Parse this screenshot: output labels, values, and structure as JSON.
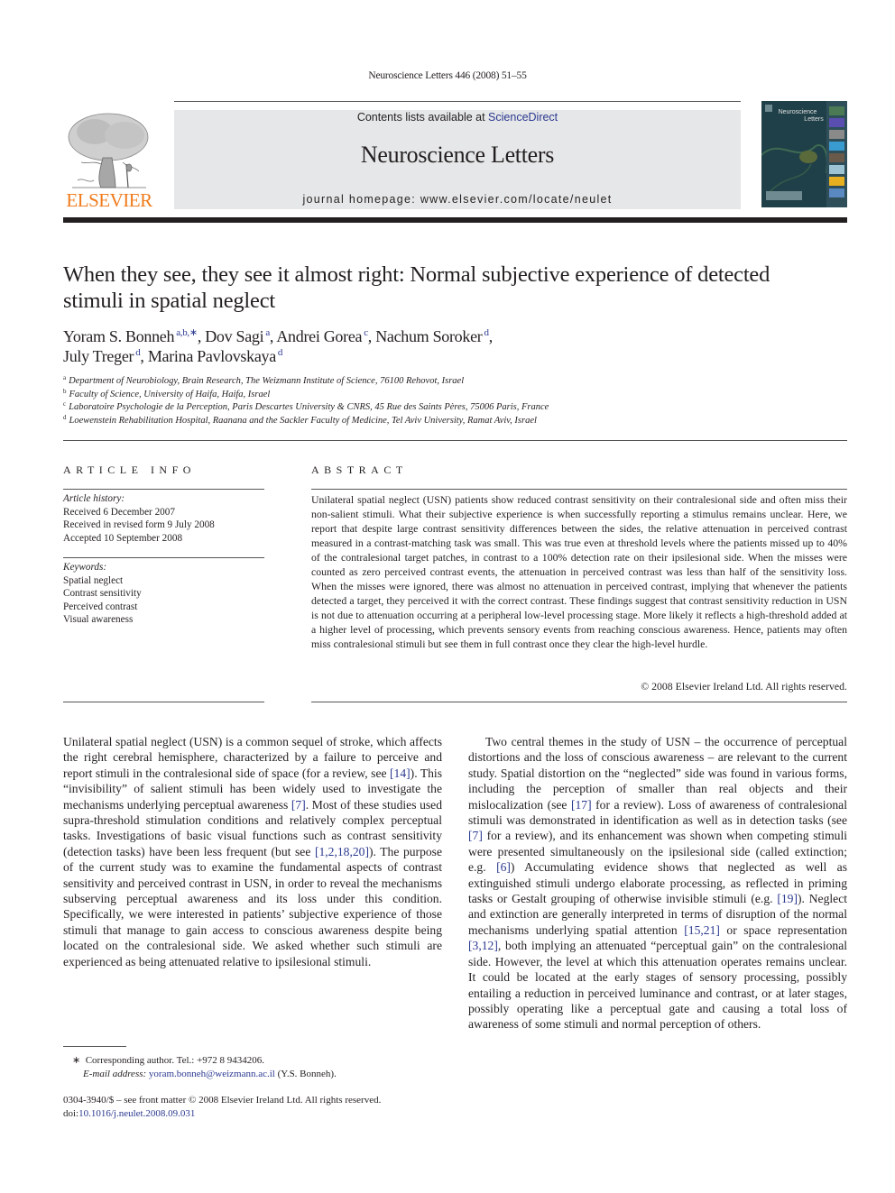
{
  "running_head": "Neuroscience Letters 446 (2008) 51–55",
  "masthead": {
    "publisher_logo_text": "ELSEVIER",
    "contents_prefix": "Contents lists available at ",
    "contents_link": "ScienceDirect",
    "journal_title": "Neuroscience Letters",
    "homepage_prefix": "journal homepage: ",
    "homepage_url": "www.elsevier.com/locate/neulet",
    "cover_title_line1": "Neuroscience",
    "cover_title_line2": "Letters"
  },
  "article": {
    "title": "When they see, they see it almost right: Normal subjective experience of detected stimuli in spatial neglect",
    "authors": [
      {
        "name": "Yoram S. Bonneh",
        "sup": "a,b,∗",
        "sep": ", "
      },
      {
        "name": "Dov Sagi",
        "sup": "a",
        "sep": ", "
      },
      {
        "name": "Andrei Gorea",
        "sup": "c",
        "sep": ", "
      },
      {
        "name": "Nachum Soroker",
        "sup": "d",
        "sep": ","
      },
      {
        "name": "July Treger",
        "sup": "d",
        "sep": ", "
      },
      {
        "name": "Marina Pavlovskaya",
        "sup": "d",
        "sep": ""
      }
    ],
    "affiliations": [
      {
        "key": "a",
        "text": "Department of Neurobiology, Brain Research, The Weizmann Institute of Science, 76100 Rehovot, Israel"
      },
      {
        "key": "b",
        "text": "Faculty of Science, University of Haifa, Haifa, Israel"
      },
      {
        "key": "c",
        "text": "Laboratoire Psychologie de la Perception, Paris Descartes University & CNRS, 45 Rue des Saints Pères, 75006 Paris, France"
      },
      {
        "key": "d",
        "text": "Loewenstein Rehabilitation Hospital, Raanana and the Sackler Faculty of Medicine, Tel Aviv University, Ramat Aviv, Israel"
      }
    ]
  },
  "article_info": {
    "heading": "ARTICLE INFO",
    "history_label": "Article history:",
    "history": [
      "Received 6 December 2007",
      "Received in revised form 9 July 2008",
      "Accepted 10 September 2008"
    ],
    "keywords_label": "Keywords:",
    "keywords": [
      "Spatial neglect",
      "Contrast sensitivity",
      "Perceived contrast",
      "Visual awareness"
    ]
  },
  "abstract": {
    "heading": "ABSTRACT",
    "text": "Unilateral spatial neglect (USN) patients show reduced contrast sensitivity on their contralesional side and often miss their non-salient stimuli. What their subjective experience is when successfully reporting a stimulus remains unclear. Here, we report that despite large contrast sensitivity differences between the sides, the relative attenuation in perceived contrast measured in a contrast-matching task was small. This was true even at threshold levels where the patients missed up to 40% of the contralesional target patches, in contrast to a 100% detection rate on their ipsilesional side. When the misses were counted as zero perceived contrast events, the attenuation in perceived contrast was less than half of the sensitivity loss. When the misses were ignored, there was almost no attenuation in perceived contrast, implying that whenever the patients detected a target, they perceived it with the correct contrast. These findings suggest that contrast sensitivity reduction in USN is not due to attenuation occurring at a peripheral low-level processing stage. More likely it reflects a high-threshold added at a higher level of processing, which pre­vents sensory events from reaching conscious awareness. Hence, patients may often miss contralesional stimuli but see them in full contrast once they clear the high-level hurdle.",
    "copyright": "© 2008 Elsevier Ireland Ltd. All rights reserved."
  },
  "body": {
    "left_paragraph": [
      {
        "t": "Unilateral spatial neglect (USN) is a common sequel of stroke, which affects the right cerebral hemisphere, characterized by a failure to perceive and report stimuli in the contralesional side of space (for a review, see "
      },
      {
        "ref": "[14]"
      },
      {
        "t": "). This “invisibility” of salient stimuli has been widely used to investigate the mechanisms underlying per­ceptual awareness "
      },
      {
        "ref": "[7]"
      },
      {
        "t": ". Most of these studies used supra-threshold stimulation conditions and relatively complex perceptual tasks. Investigations of basic visual functions such as contrast sensitiv­ity (detection tasks) have been less frequent (but see "
      },
      {
        "ref": "[1,2,18,20]"
      },
      {
        "t": "). The purpose of the current study was to examine the fundamen­tal aspects of contrast sensitivity and perceived contrast in USN, in order to reveal the mechanisms subserving perceptual awareness and its loss under this condition. Specifically, we were interested in patients’ subjective experience of those stimuli that manage to gain access to conscious awareness despite being located on the con­tralesional side. We asked whether such stimuli are experienced as being attenuated relative to ipsilesional stimuli."
      }
    ],
    "right_paragraph": [
      {
        "t": "Two central themes in the study of USN – the occurrence of perceptual distortions and the loss of conscious awareness – are relevant to the current study. Spatial distortion on the “neglected” side was found in various forms, including the perception of smaller than real objects and their mislocalization (see "
      },
      {
        "ref": "[17]"
      },
      {
        "t": " for a review). Loss of awareness of contralesional stimuli was demonstrated in identification as well as in detection tasks (see "
      },
      {
        "ref": "[7]"
      },
      {
        "t": " for a review), and its enhancement was shown when competing stimuli were presented simultaneously on the ipsilesional side (called extinc­tion; e.g. "
      },
      {
        "ref": "[6]"
      },
      {
        "t": ") Accumulating evidence shows that neglected as well as extinguished stimuli undergo elaborate processing, as reflected in priming tasks or Gestalt grouping of otherwise invisible stim­uli (e.g. "
      },
      {
        "ref": "[19]"
      },
      {
        "t": "). Neglect and extinction are generally interpreted in terms of disruption of the normal mechanisms underlying spatial attention "
      },
      {
        "ref": "[15,21]"
      },
      {
        "t": " or space representation "
      },
      {
        "ref": "[3,12]"
      },
      {
        "t": ", both implying an attenuated “perceptual gain” on the contralesional side. However, the level at which this attenuation operates remains unclear. It could be located at the early stages of sensory processing, possi­bly entailing a reduction in perceived luminance and contrast, or at later stages, possibly operating like a perceptual gate and causing a total loss of awareness of some stimuli and normal perception of others."
      }
    ]
  },
  "footnote": {
    "marker": "∗",
    "corresponding": "Corresponding author. Tel.: +972 8 9434206.",
    "email_label": "E-mail address: ",
    "email": "yoram.bonneh@weizmann.ac.il",
    "email_suffix": " (Y.S. Bonneh)."
  },
  "front_matter": {
    "issn_line": "0304-3940/$ – see front matter © 2008 Elsevier Ireland Ltd. All rights reserved.",
    "doi_label": "doi:",
    "doi": "10.1016/j.neulet.2008.09.031"
  },
  "colors": {
    "link": "#2b3990",
    "elsevier_orange": "#f07b1c",
    "masthead_bg": "#e6e7e8"
  }
}
